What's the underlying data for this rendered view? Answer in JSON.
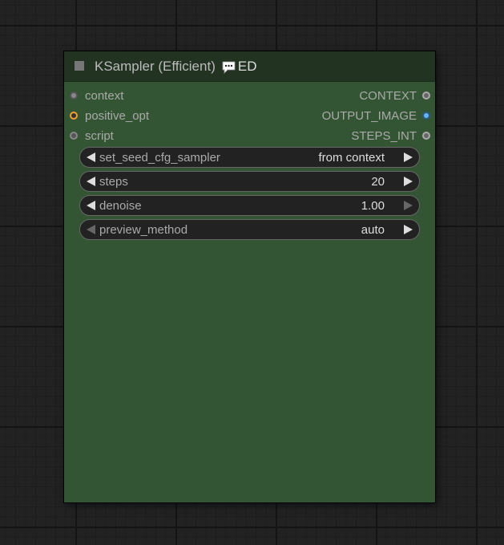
{
  "node": {
    "title": "KSampler (Efficient)",
    "badge_icon": "speech-bubble-icon",
    "badge_label": "ED",
    "colors": {
      "body": "#335533",
      "header": "#223322",
      "title": "#bbbbbb"
    }
  },
  "inputs": [
    {
      "label": "context",
      "color": "#888888"
    },
    {
      "label": "positive_opt",
      "color": "#f0a030"
    },
    {
      "label": "script",
      "color": "#888888"
    }
  ],
  "outputs": [
    {
      "label": "CONTEXT",
      "color": "#888888"
    },
    {
      "label": "OUTPUT_IMAGE",
      "color": "#64b5f6"
    },
    {
      "label": "STEPS_INT",
      "color": "#888888"
    }
  ],
  "widgets": [
    {
      "label": "set_seed_cfg_sampler",
      "value": "from context"
    },
    {
      "label": "steps",
      "value": "20"
    },
    {
      "label": "denoise",
      "value": "1.00"
    },
    {
      "label": "preview_method",
      "value": "auto"
    }
  ]
}
